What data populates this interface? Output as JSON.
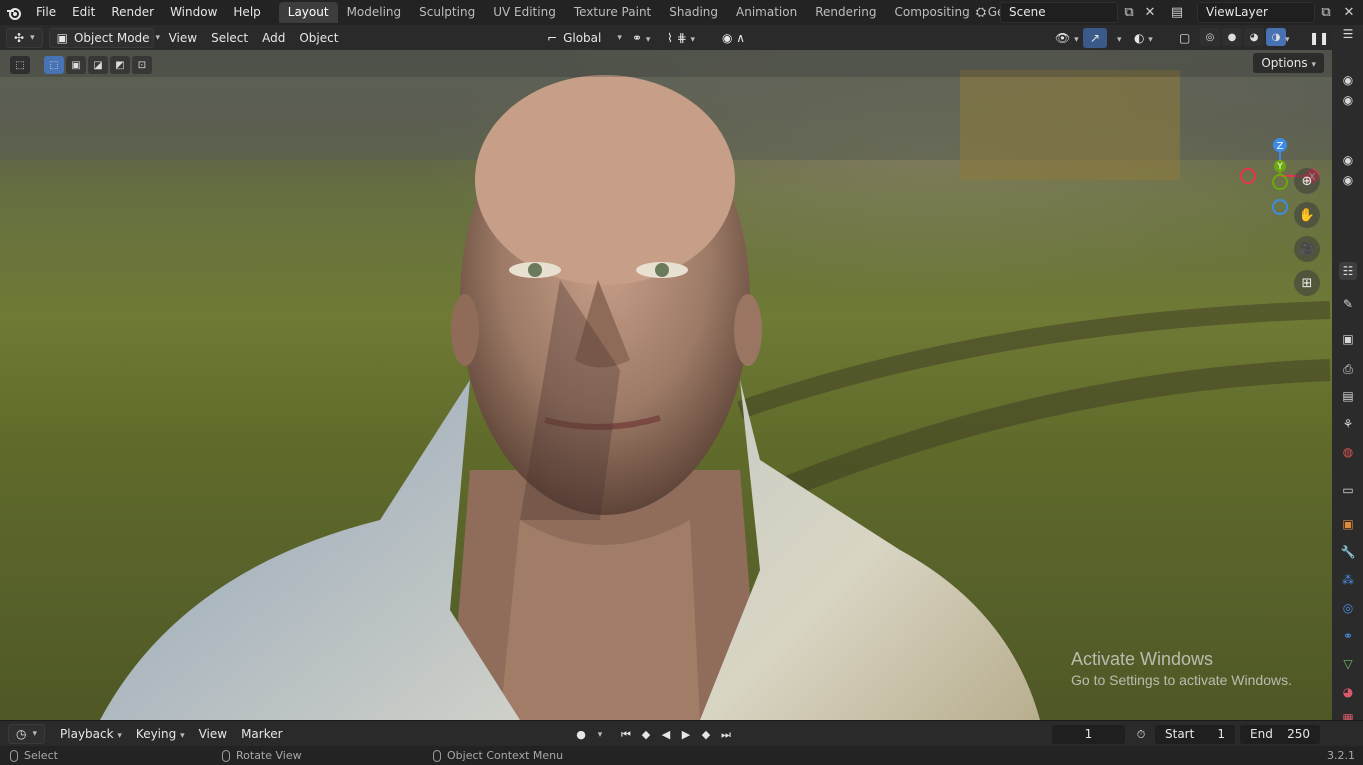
{
  "topbar": {
    "menus": [
      "File",
      "Edit",
      "Render",
      "Window",
      "Help"
    ],
    "workspaces": [
      "Layout",
      "Modeling",
      "Sculpting",
      "UV Editing",
      "Texture Paint",
      "Shading",
      "Animation",
      "Rendering",
      "Compositing",
      "Geometry Noc"
    ],
    "active_workspace": "Layout",
    "scene": "Scene",
    "view_layer": "ViewLayer"
  },
  "header": {
    "mode": "Object Mode",
    "menus": [
      "View",
      "Select",
      "Add",
      "Object"
    ],
    "transform_orientation": "Global",
    "options_label": "Options"
  },
  "gizmo": {
    "z_label": "Z",
    "x_label": "X",
    "y_label": "Y",
    "colors": {
      "x": "#e8344e",
      "y": "#6ea80f",
      "z": "#3b8be8"
    }
  },
  "watermark": {
    "title": "Activate Windows",
    "subtitle": "Go to Settings to activate Windows."
  },
  "timeline": {
    "menus": [
      "Playback",
      "Keying",
      "View",
      "Marker"
    ],
    "current_frame": "1",
    "start_label": "Start",
    "start_value": "1",
    "end_label": "End",
    "end_value": "250"
  },
  "statusbar": {
    "select": "Select",
    "rotate": "Rotate View",
    "context": "Object Context Menu",
    "version": "3.2.1"
  }
}
